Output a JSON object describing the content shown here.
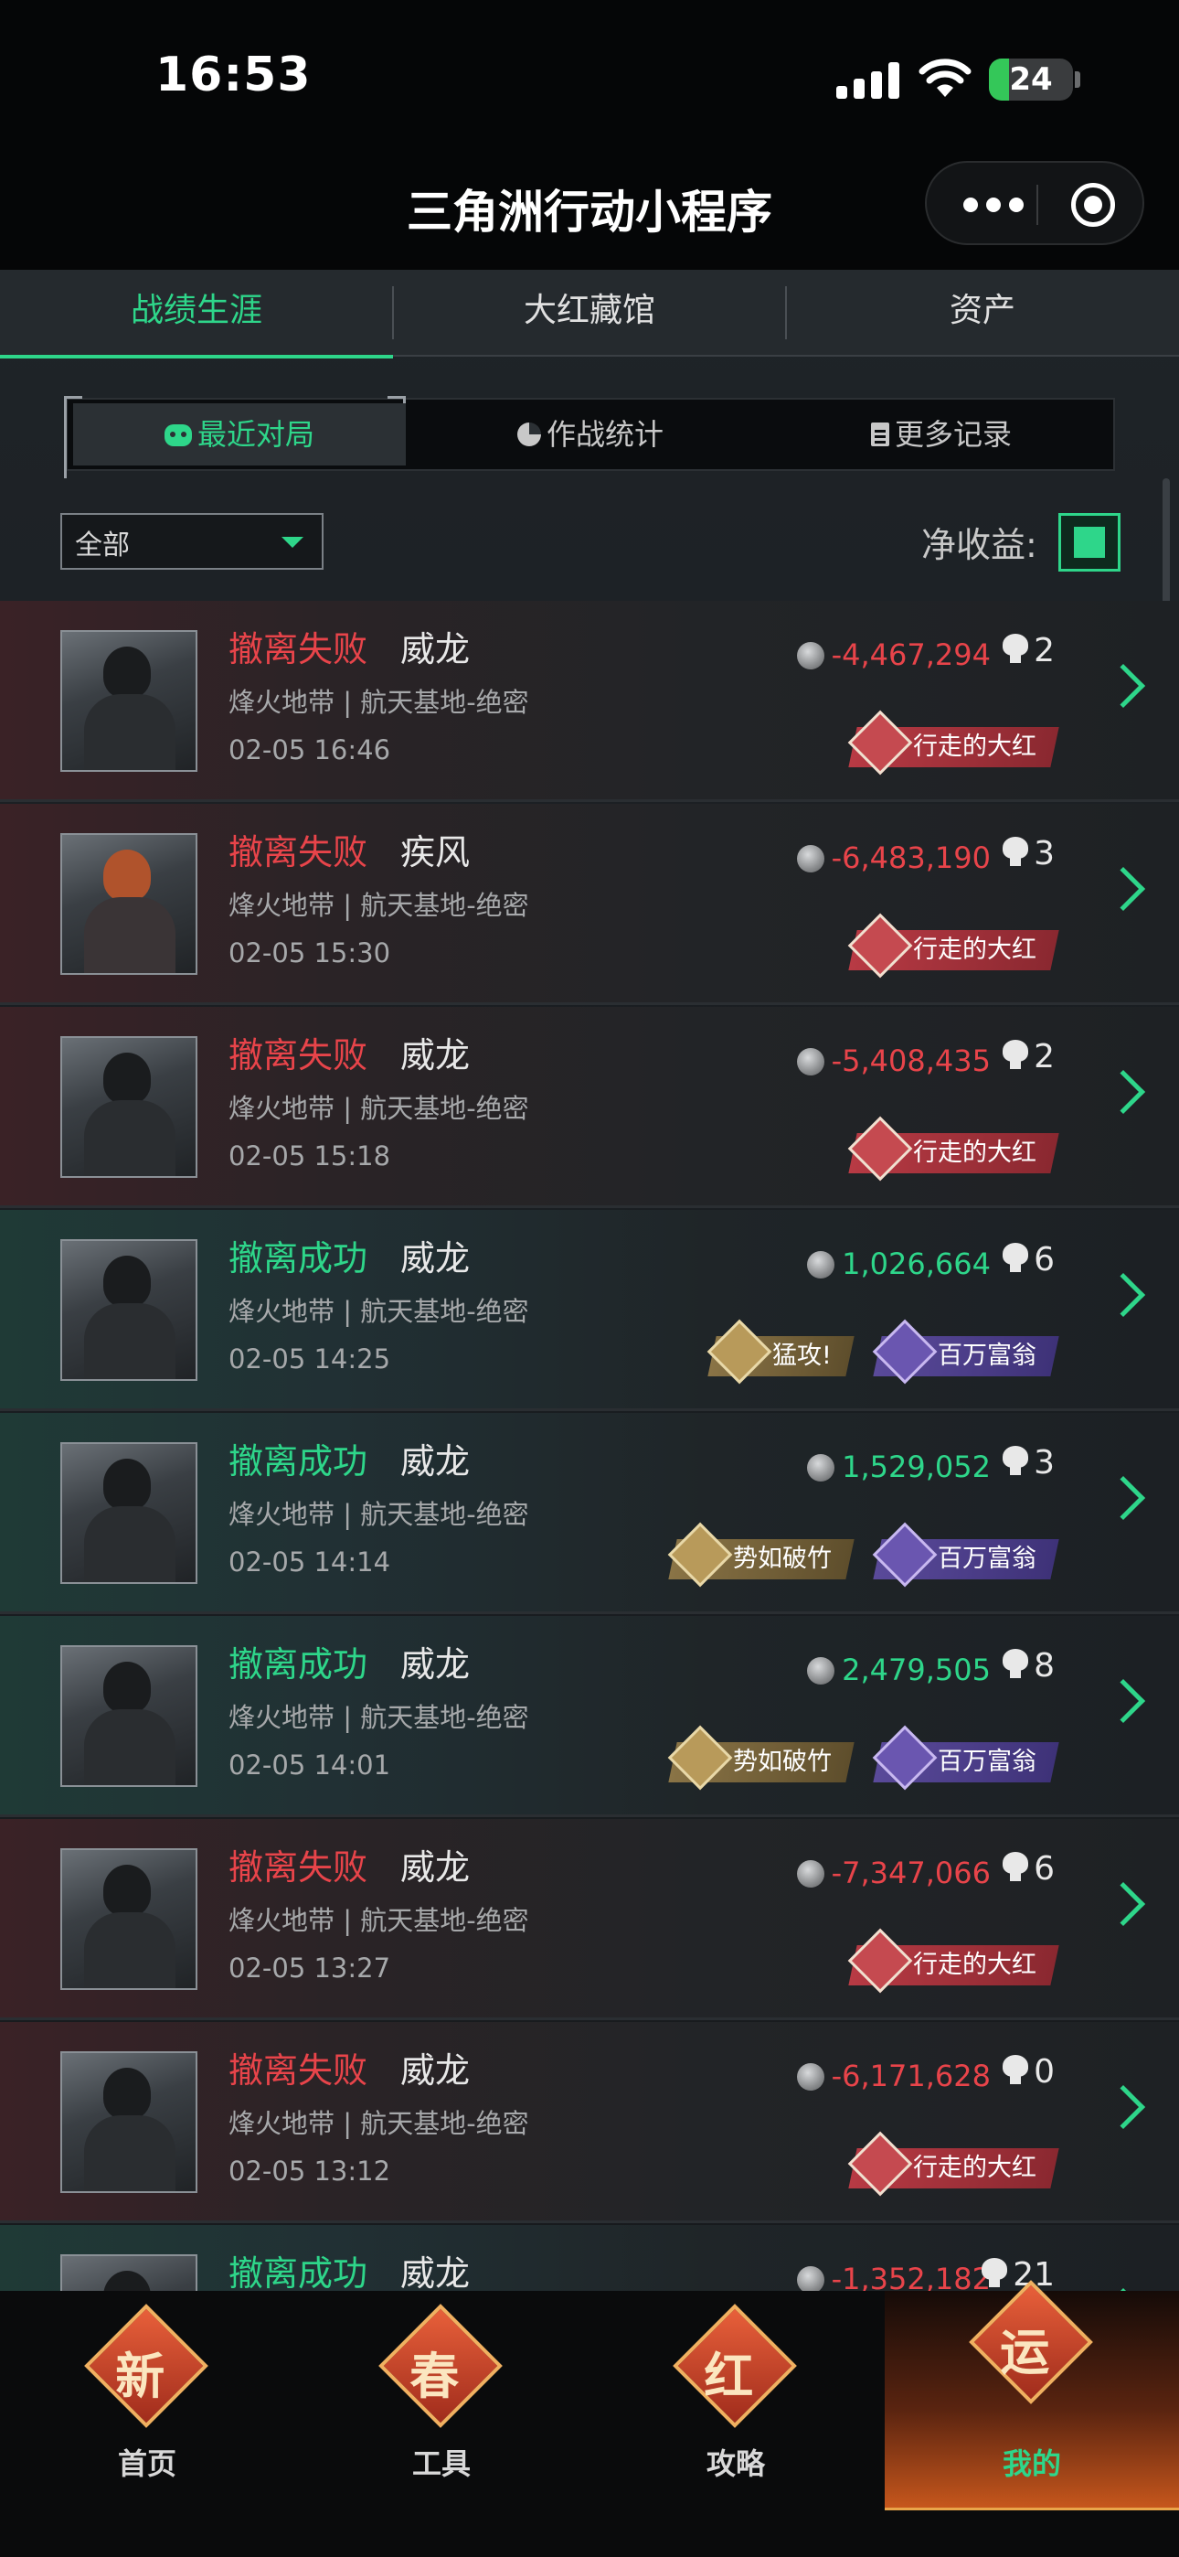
{
  "status_bar": {
    "time": "16:53",
    "battery": "24"
  },
  "navbar": {
    "title": "三角洲行动小程序",
    "more_icon": "more-dots-icon",
    "close_icon": "target-circle-icon"
  },
  "tabs": [
    {
      "label": "战绩生涯",
      "active": true
    },
    {
      "label": "大红藏馆",
      "active": false
    },
    {
      "label": "资产",
      "active": false
    }
  ],
  "segments": [
    {
      "label": "最近对局",
      "icon": "gamepad-icon",
      "active": true
    },
    {
      "label": "作战统计",
      "icon": "pie-chart-icon",
      "active": false
    },
    {
      "label": "更多记录",
      "icon": "document-icon",
      "active": false
    }
  ],
  "filter": {
    "selected": "全部"
  },
  "net_income": {
    "label": "净收益:",
    "checked": true
  },
  "matches": [
    {
      "result": "撤离失败",
      "status": "fail",
      "operator": "威龙",
      "map": "烽火地带 | 航天基地-绝密",
      "time": "02-05 16:46",
      "money": "-4,467,294",
      "kills": "2",
      "badges": [
        {
          "label": "行走的大红",
          "color": "red"
        }
      ]
    },
    {
      "result": "撤离失败",
      "status": "fail",
      "operator": "疾风",
      "map": "烽火地带 | 航天基地-绝密",
      "time": "02-05 15:30",
      "money": "-6,483,190",
      "kills": "3",
      "badges": [
        {
          "label": "行走的大红",
          "color": "red"
        }
      ]
    },
    {
      "result": "撤离失败",
      "status": "fail",
      "operator": "威龙",
      "map": "烽火地带 | 航天基地-绝密",
      "time": "02-05 15:18",
      "money": "-5,408,435",
      "kills": "2",
      "badges": [
        {
          "label": "行走的大红",
          "color": "red"
        }
      ]
    },
    {
      "result": "撤离成功",
      "status": "win",
      "operator": "威龙",
      "map": "烽火地带 | 航天基地-绝密",
      "time": "02-05 14:25",
      "money": "1,026,664",
      "kills": "6",
      "badges": [
        {
          "label": "猛攻!",
          "color": "gold"
        },
        {
          "label": "百万富翁",
          "color": "purple"
        }
      ]
    },
    {
      "result": "撤离成功",
      "status": "win",
      "operator": "威龙",
      "map": "烽火地带 | 航天基地-绝密",
      "time": "02-05 14:14",
      "money": "1,529,052",
      "kills": "3",
      "badges": [
        {
          "label": "势如破竹",
          "color": "gold"
        },
        {
          "label": "百万富翁",
          "color": "purple"
        }
      ]
    },
    {
      "result": "撤离成功",
      "status": "win",
      "operator": "威龙",
      "map": "烽火地带 | 航天基地-绝密",
      "time": "02-05 14:01",
      "money": "2,479,505",
      "kills": "8",
      "badges": [
        {
          "label": "势如破竹",
          "color": "gold"
        },
        {
          "label": "百万富翁",
          "color": "purple"
        }
      ]
    },
    {
      "result": "撤离失败",
      "status": "fail",
      "operator": "威龙",
      "map": "烽火地带 | 航天基地-绝密",
      "time": "02-05 13:27",
      "money": "-7,347,066",
      "kills": "6",
      "badges": [
        {
          "label": "行走的大红",
          "color": "red"
        }
      ]
    },
    {
      "result": "撤离失败",
      "status": "fail",
      "operator": "威龙",
      "map": "烽火地带 | 航天基地-绝密",
      "time": "02-05 13:12",
      "money": "-6,171,628",
      "kills": "0",
      "badges": [
        {
          "label": "行走的大红",
          "color": "red"
        }
      ]
    },
    {
      "result": "撤离成功",
      "status": "win",
      "operator": "威龙",
      "map": "",
      "time": "",
      "money": "-1,352,182",
      "kills": "21",
      "badges": []
    }
  ],
  "bottom_nav": [
    {
      "icon_char": "新",
      "label": "首页",
      "active": false
    },
    {
      "icon_char": "春",
      "label": "工具",
      "active": false
    },
    {
      "icon_char": "红",
      "label": "攻略",
      "active": false
    },
    {
      "icon_char": "运",
      "label": "我的",
      "active": true
    }
  ],
  "colors": {
    "accent": "#2ed68a",
    "fail": "#e8444a"
  }
}
